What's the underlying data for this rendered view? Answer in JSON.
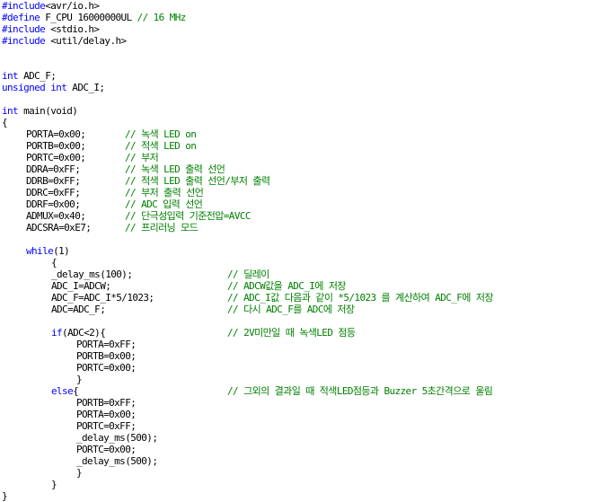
{
  "editor": {
    "lines": [
      {
        "indent": 0,
        "kw": "#include",
        "code": "<avr/io.h>",
        "comment": ""
      },
      {
        "indent": 0,
        "kw": "#define",
        "code": " F_CPU 16000000UL ",
        "comment": "// 16 MHz",
        "inline": true
      },
      {
        "indent": 0,
        "kw": "#include",
        "code": " <stdio.h>",
        "comment": ""
      },
      {
        "indent": 0,
        "kw": "#include",
        "code": " <util/delay.h>",
        "comment": ""
      },
      {
        "indent": 0,
        "kw": "",
        "code": "",
        "comment": ""
      },
      {
        "indent": 0,
        "kw": "",
        "code": "",
        "comment": ""
      },
      {
        "indent": 0,
        "kw": "int",
        "code": " ADC_F;",
        "comment": ""
      },
      {
        "indent": 0,
        "kw": "unsigned int",
        "code": " ADC_I;",
        "comment": ""
      },
      {
        "indent": 0,
        "kw": "",
        "code": "",
        "comment": ""
      },
      {
        "indent": 0,
        "kw": "int",
        "code": " main(void)",
        "comment": ""
      },
      {
        "indent": 0,
        "kw": "",
        "code": "{",
        "comment": ""
      },
      {
        "indent": 1,
        "kw": "",
        "code": "PORTA=0x00;",
        "comment": "// 녹색 LED on",
        "col": 1
      },
      {
        "indent": 1,
        "kw": "",
        "code": "PORTB=0x00;",
        "comment": "// 적색 LED on",
        "col": 1
      },
      {
        "indent": 1,
        "kw": "",
        "code": "PORTC=0x00;",
        "comment": "// 부저",
        "col": 1
      },
      {
        "indent": 1,
        "kw": "",
        "code": "DDRA=0xFF;",
        "comment": "// 녹색 LED 출력 선언",
        "col": 1
      },
      {
        "indent": 1,
        "kw": "",
        "code": "DDRB=0xFF;",
        "comment": "// 적색 LED 출력 선언/부저 출력",
        "col": 1
      },
      {
        "indent": 1,
        "kw": "",
        "code": "DDRC=0xFF;",
        "comment": "// 부저 출력 선언",
        "col": 1
      },
      {
        "indent": 1,
        "kw": "",
        "code": "DDRF=0x00;",
        "comment": "// ADC 입력 선언",
        "col": 1
      },
      {
        "indent": 1,
        "kw": "",
        "code": "ADMUX=0x40;",
        "comment": "// 단극성입력 기준전압=AVCC",
        "col": 1
      },
      {
        "indent": 1,
        "kw": "",
        "code": "ADCSRA=0xE7;",
        "comment": "// 프리러닝 모드",
        "col": 1
      },
      {
        "indent": 0,
        "kw": "",
        "code": "",
        "comment": ""
      },
      {
        "indent": 1,
        "kw": "while",
        "code": "(1)",
        "comment": ""
      },
      {
        "indent": 2,
        "kw": "",
        "code": "{",
        "comment": ""
      },
      {
        "indent": 2,
        "kw": "",
        "code": "_delay_ms(100);",
        "comment": "// 딜레이",
        "col": 2
      },
      {
        "indent": 2,
        "kw": "",
        "code": "ADC_I=ADCW;",
        "comment": "// ADCW값을 ADC_I에 저장",
        "col": 2
      },
      {
        "indent": 2,
        "kw": "",
        "code": "ADC_F=ADC_I*5/1023;",
        "comment": "// ADC_I값 다음과 같이 *5/1023 를 계산하여 ADC_F에 저장",
        "col": 2
      },
      {
        "indent": 2,
        "kw": "",
        "code": "ADC=ADC_F;",
        "comment": "// 다시 ADC_F를 ADC에 저장",
        "col": 2
      },
      {
        "indent": 0,
        "kw": "",
        "code": "",
        "comment": ""
      },
      {
        "indent": 2,
        "kw": "if",
        "code": "(ADC<2){",
        "comment": "// 2V미만일 때 녹색LED 점등",
        "col": 2
      },
      {
        "indent": 3,
        "kw": "",
        "code": "PORTA=0xFF;",
        "comment": ""
      },
      {
        "indent": 3,
        "kw": "",
        "code": "PORTB=0x00;",
        "comment": ""
      },
      {
        "indent": 3,
        "kw": "",
        "code": "PORTC=0x00;",
        "comment": ""
      },
      {
        "indent": 3,
        "kw": "",
        "code": "}",
        "comment": ""
      },
      {
        "indent": 2,
        "kw": "else",
        "code": "{",
        "comment": "// 그외의 결과일 때 적색LED점등과 Buzzer 5초간격으로 울림",
        "col": 2
      },
      {
        "indent": 3,
        "kw": "",
        "code": "PORTB=0xFF;",
        "comment": ""
      },
      {
        "indent": 3,
        "kw": "",
        "code": "PORTA=0x00;",
        "comment": ""
      },
      {
        "indent": 3,
        "kw": "",
        "code": "PORTC=0xFF;",
        "comment": ""
      },
      {
        "indent": 3,
        "kw": "",
        "code": "_delay_ms(500);",
        "comment": ""
      },
      {
        "indent": 3,
        "kw": "",
        "code": "PORTC=0x00;",
        "comment": ""
      },
      {
        "indent": 3,
        "kw": "",
        "code": "_delay_ms(500);",
        "comment": ""
      },
      {
        "indent": 3,
        "kw": "",
        "code": "}",
        "comment": ""
      },
      {
        "indent": 2,
        "kw": "",
        "code": "}",
        "comment": ""
      },
      {
        "indent": 0,
        "kw": "",
        "code": "}",
        "comment": ""
      }
    ]
  },
  "colors": {
    "keyword": "#0000ff",
    "comment": "#008000",
    "text": "#000000",
    "background": "#ffffff"
  }
}
